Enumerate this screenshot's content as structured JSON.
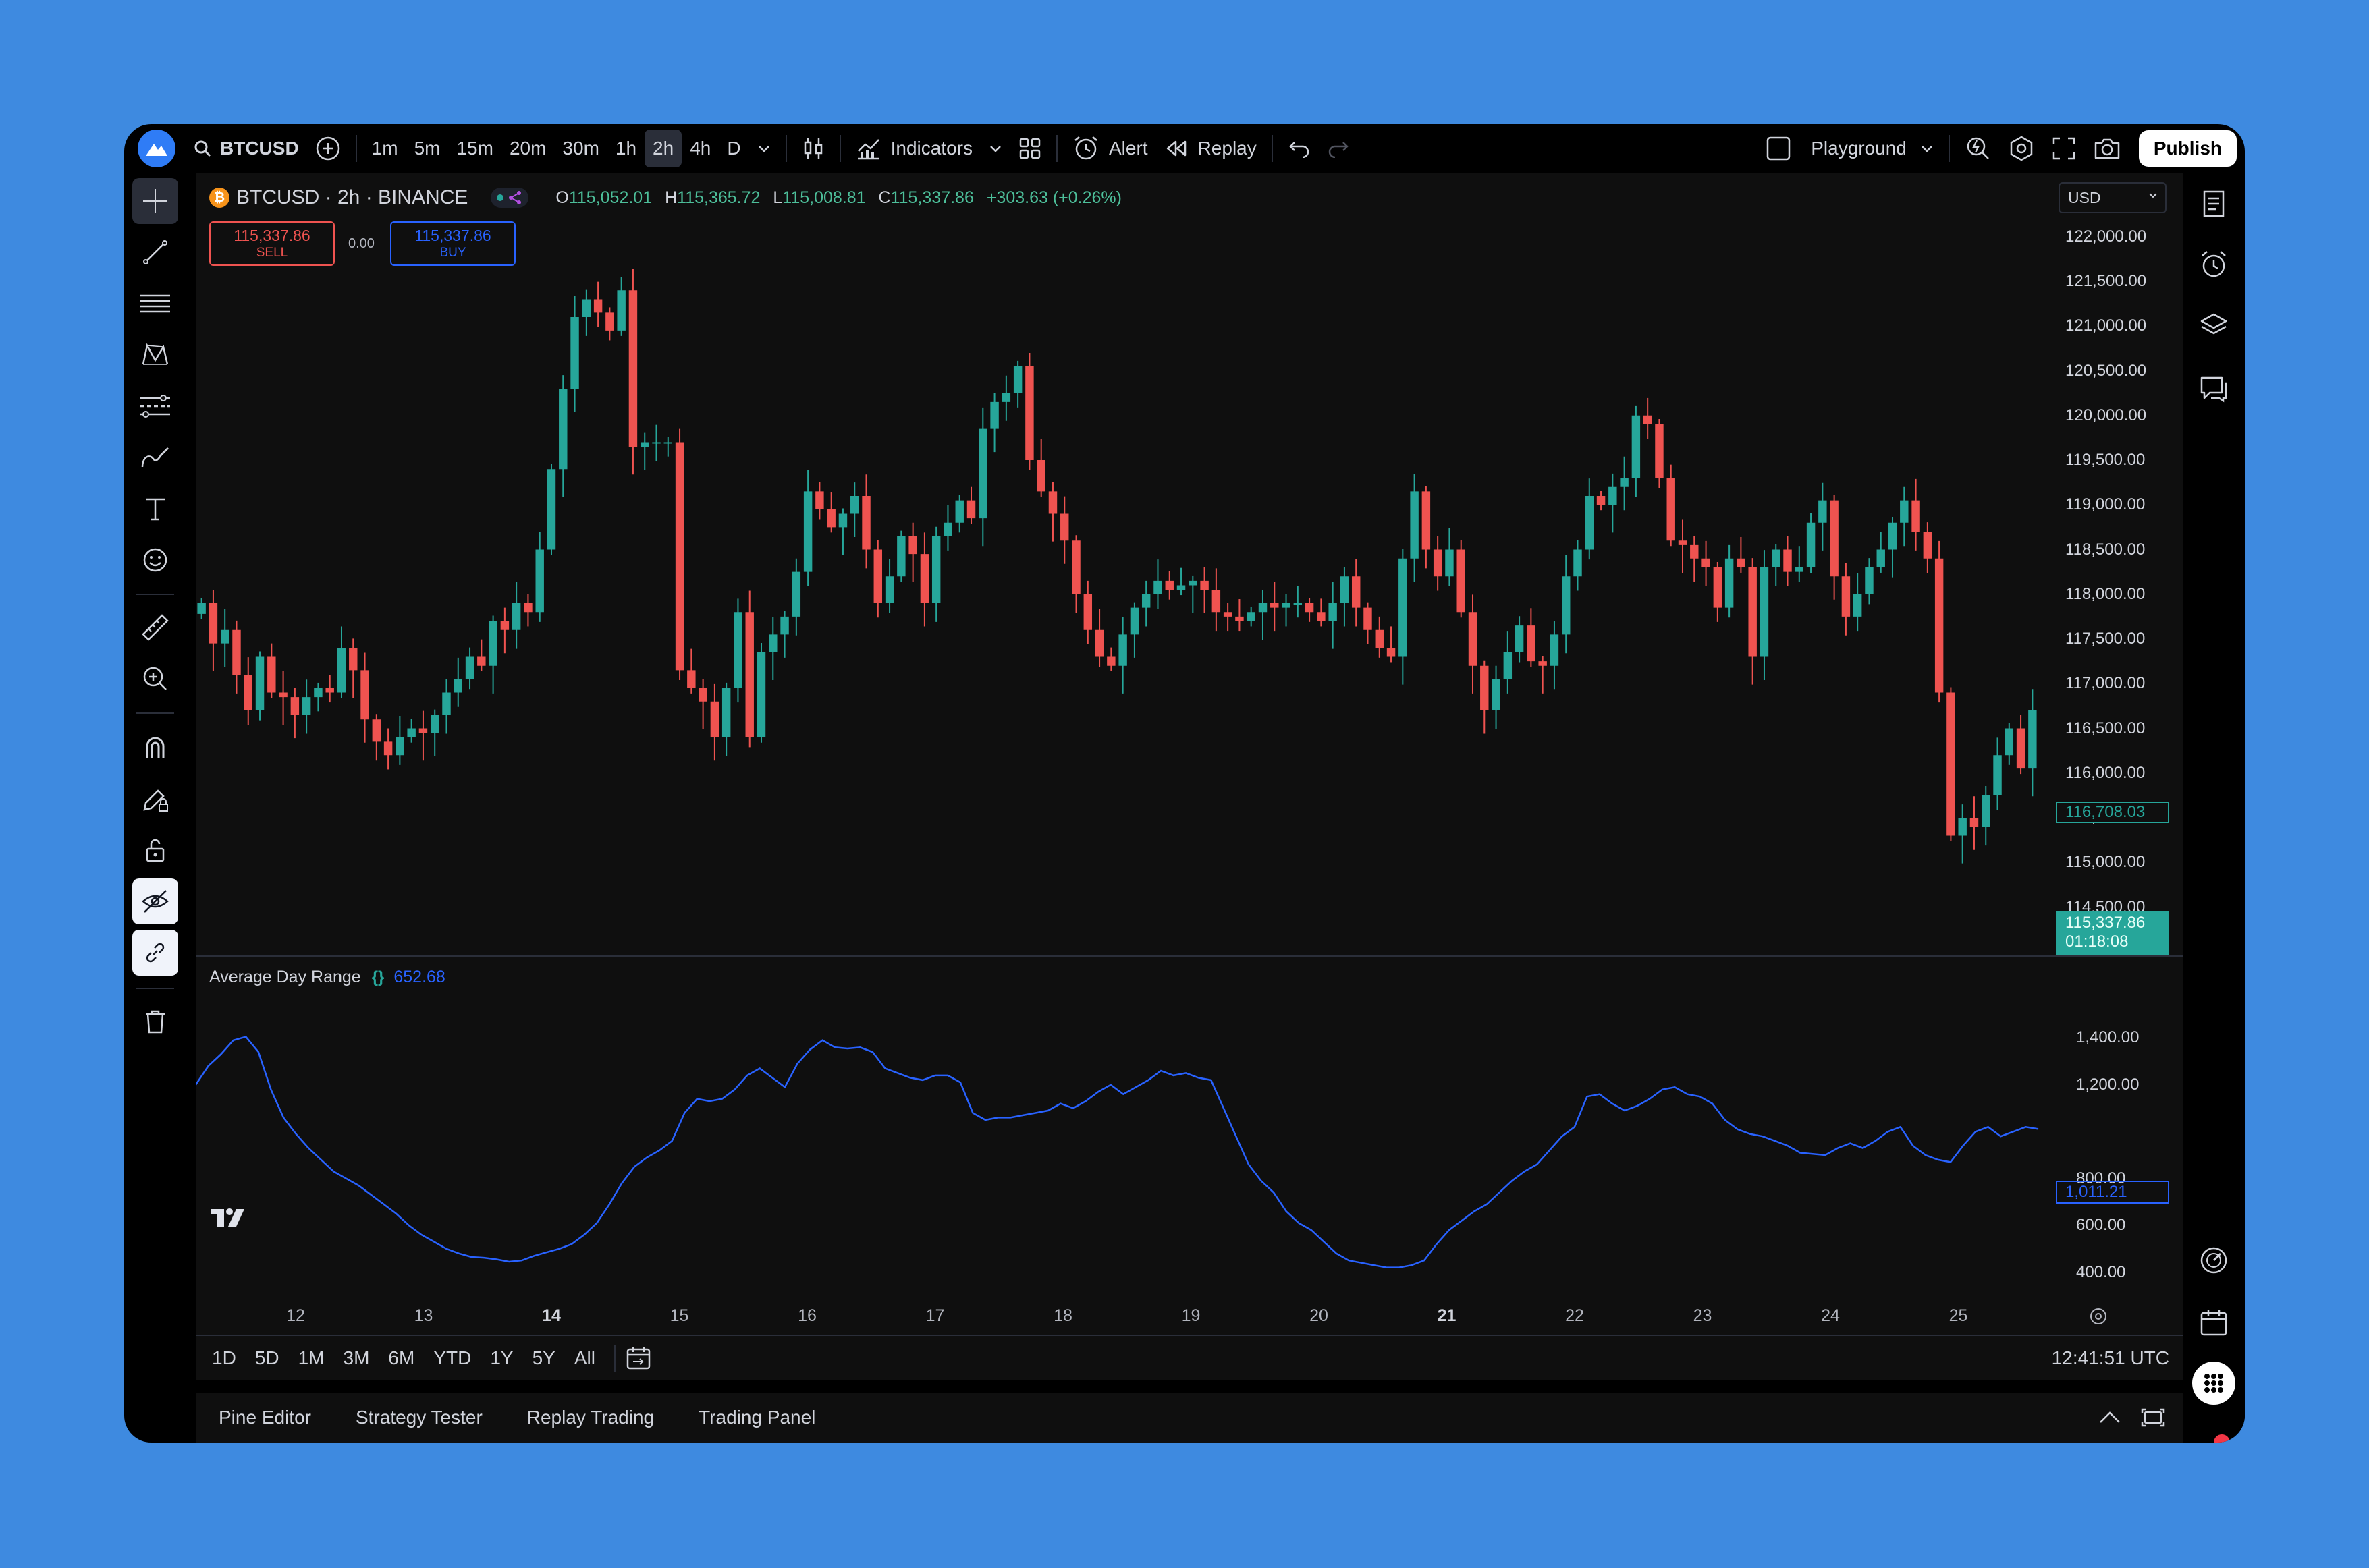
{
  "topbar": {
    "symbol": "BTCUSD",
    "timeframes": [
      "1m",
      "5m",
      "15m",
      "20m",
      "30m",
      "1h",
      "2h",
      "4h",
      "D"
    ],
    "active_timeframe": "2h",
    "indicators_label": "Indicators",
    "alert_label": "Alert",
    "replay_label": "Replay",
    "layout_name": "Playground",
    "publish_label": "Publish"
  },
  "legend": {
    "title": "BTCUSD · 2h · BINANCE",
    "o_label": "O",
    "o_value": "115,052.01",
    "h_label": "H",
    "h_value": "115,365.72",
    "l_label": "L",
    "l_value": "115,008.81",
    "c_label": "C",
    "c_value": "115,337.86",
    "change": "+303.63 (+0.26%)"
  },
  "trade": {
    "sell_price": "115,337.86",
    "sell_label": "SELL",
    "spread": "0.00",
    "buy_price": "115,337.86",
    "buy_label": "BUY"
  },
  "currency": "USD",
  "price_axis": [
    "122,000.00",
    "121,500.00",
    "121,000.00",
    "120,500.00",
    "120,000.00",
    "119,500.00",
    "119,000.00",
    "118,500.00",
    "118,000.00",
    "117,500.00",
    "117,000.00",
    "116,500.00",
    "116,000.00",
    "115,500.00",
    "115,000.00",
    "114,500.00"
  ],
  "price_marker_alt": "116,708.03",
  "price_marker": {
    "price": "115,337.86",
    "countdown": "01:18:08"
  },
  "indicator": {
    "name": "Average Day Range",
    "value": "652.68",
    "axis": [
      "1,400.00",
      "1,200.00",
      "800.00",
      "600.00",
      "400.00"
    ],
    "marker": "1,011.21"
  },
  "time_axis": [
    {
      "label": "12",
      "bold": false
    },
    {
      "label": "13",
      "bold": false
    },
    {
      "label": "14",
      "bold": true
    },
    {
      "label": "15",
      "bold": false
    },
    {
      "label": "16",
      "bold": false
    },
    {
      "label": "17",
      "bold": false
    },
    {
      "label": "18",
      "bold": false
    },
    {
      "label": "19",
      "bold": false
    },
    {
      "label": "20",
      "bold": false
    },
    {
      "label": "21",
      "bold": true
    },
    {
      "label": "22",
      "bold": false
    },
    {
      "label": "23",
      "bold": false
    },
    {
      "label": "24",
      "bold": false
    },
    {
      "label": "25",
      "bold": false
    }
  ],
  "ranges": [
    "1D",
    "5D",
    "1M",
    "3M",
    "6M",
    "YTD",
    "1Y",
    "5Y",
    "All"
  ],
  "clock": "12:41:51 UTC",
  "bottom_tabs": [
    "Pine Editor",
    "Strategy Tester",
    "Replay Trading",
    "Trading Panel"
  ],
  "colors": {
    "up": "#26a69a",
    "down": "#ef5350",
    "indicator_line": "#2962ff",
    "background": "#0f0f0f",
    "page": "#3e8ae0"
  },
  "chart_data": {
    "type": "candlestick",
    "timeframe": "2h",
    "x_labels": [
      "12",
      "13",
      "14",
      "15",
      "16",
      "17",
      "18",
      "19",
      "20",
      "21",
      "22",
      "23",
      "24",
      "25"
    ],
    "ylim": [
      114300,
      122300
    ],
    "close": [
      117900,
      117450,
      117600,
      117100,
      116700,
      117300,
      116900,
      116850,
      116650,
      116850,
      116950,
      116900,
      117400,
      117150,
      116600,
      116350,
      116200,
      116400,
      116500,
      116450,
      116650,
      116900,
      117050,
      117300,
      117200,
      117700,
      117600,
      117900,
      117800,
      118500,
      119400,
      120300,
      121100,
      121300,
      121150,
      120950,
      121400,
      119650,
      119700,
      119700,
      119700,
      117150,
      116950,
      116800,
      116400,
      116950,
      117800,
      116400,
      117350,
      117550,
      117750,
      118250,
      119150,
      118950,
      118750,
      118900,
      119100,
      118500,
      117900,
      118200,
      118650,
      118450,
      117900,
      118650,
      118800,
      119050,
      118850,
      119850,
      120150,
      120250,
      120550,
      119500,
      119150,
      118900,
      118600,
      118000,
      117600,
      117300,
      117200,
      117550,
      117850,
      118000,
      118150,
      118050,
      118100,
      118150,
      118050,
      117800,
      117750,
      117700,
      117800,
      117900,
      117850,
      117900,
      117900,
      117800,
      117700,
      117900,
      118200,
      117850,
      117600,
      117400,
      117300,
      118400,
      119150,
      118500,
      118200,
      118500,
      117800,
      117200,
      116700,
      117050,
      117350,
      117650,
      117250,
      117200,
      117550,
      118200,
      118500,
      119100,
      119000,
      119200,
      119300,
      120000,
      119900,
      119300,
      118600,
      118550,
      118400,
      118300,
      117850,
      118400,
      118300,
      117300,
      118300,
      118500,
      118250,
      118300,
      118800,
      119050,
      118200,
      117750,
      118000,
      118300,
      118500,
      118800,
      119050,
      118700,
      118400,
      116900,
      115300,
      115500,
      115400,
      115750,
      116200,
      116500,
      116050,
      116700
    ],
    "indicator_series": {
      "name": "Average Day Range",
      "values": [
        1200,
        1280,
        1330,
        1390,
        1405,
        1340,
        1180,
        1060,
        990,
        930,
        880,
        830,
        800,
        770,
        730,
        690,
        650,
        600,
        560,
        530,
        500,
        480,
        465,
        462,
        455,
        445,
        450,
        470,
        485,
        500,
        520,
        560,
        610,
        690,
        780,
        850,
        890,
        920,
        960,
        1080,
        1140,
        1130,
        1140,
        1180,
        1240,
        1270,
        1230,
        1190,
        1290,
        1350,
        1390,
        1360,
        1355,
        1360,
        1340,
        1270,
        1250,
        1230,
        1220,
        1240,
        1240,
        1210,
        1080,
        1050,
        1060,
        1060,
        1070,
        1080,
        1090,
        1120,
        1100,
        1130,
        1170,
        1200,
        1160,
        1190,
        1220,
        1260,
        1240,
        1250,
        1230,
        1220,
        1100,
        980,
        860,
        790,
        740,
        660,
        610,
        580,
        530,
        480,
        450,
        440,
        430,
        420,
        420,
        430,
        450,
        520,
        580,
        620,
        660,
        690,
        740,
        790,
        830,
        860,
        920,
        980,
        1020,
        1150,
        1160,
        1120,
        1090,
        1110,
        1140,
        1180,
        1190,
        1160,
        1150,
        1120,
        1050,
        1010,
        990,
        980,
        960,
        940,
        910,
        905,
        900,
        930,
        950,
        930,
        960,
        1000,
        1020,
        940,
        900,
        880,
        870,
        940,
        1000,
        1020,
        980,
        1000,
        1020,
        1011
      ]
    }
  }
}
